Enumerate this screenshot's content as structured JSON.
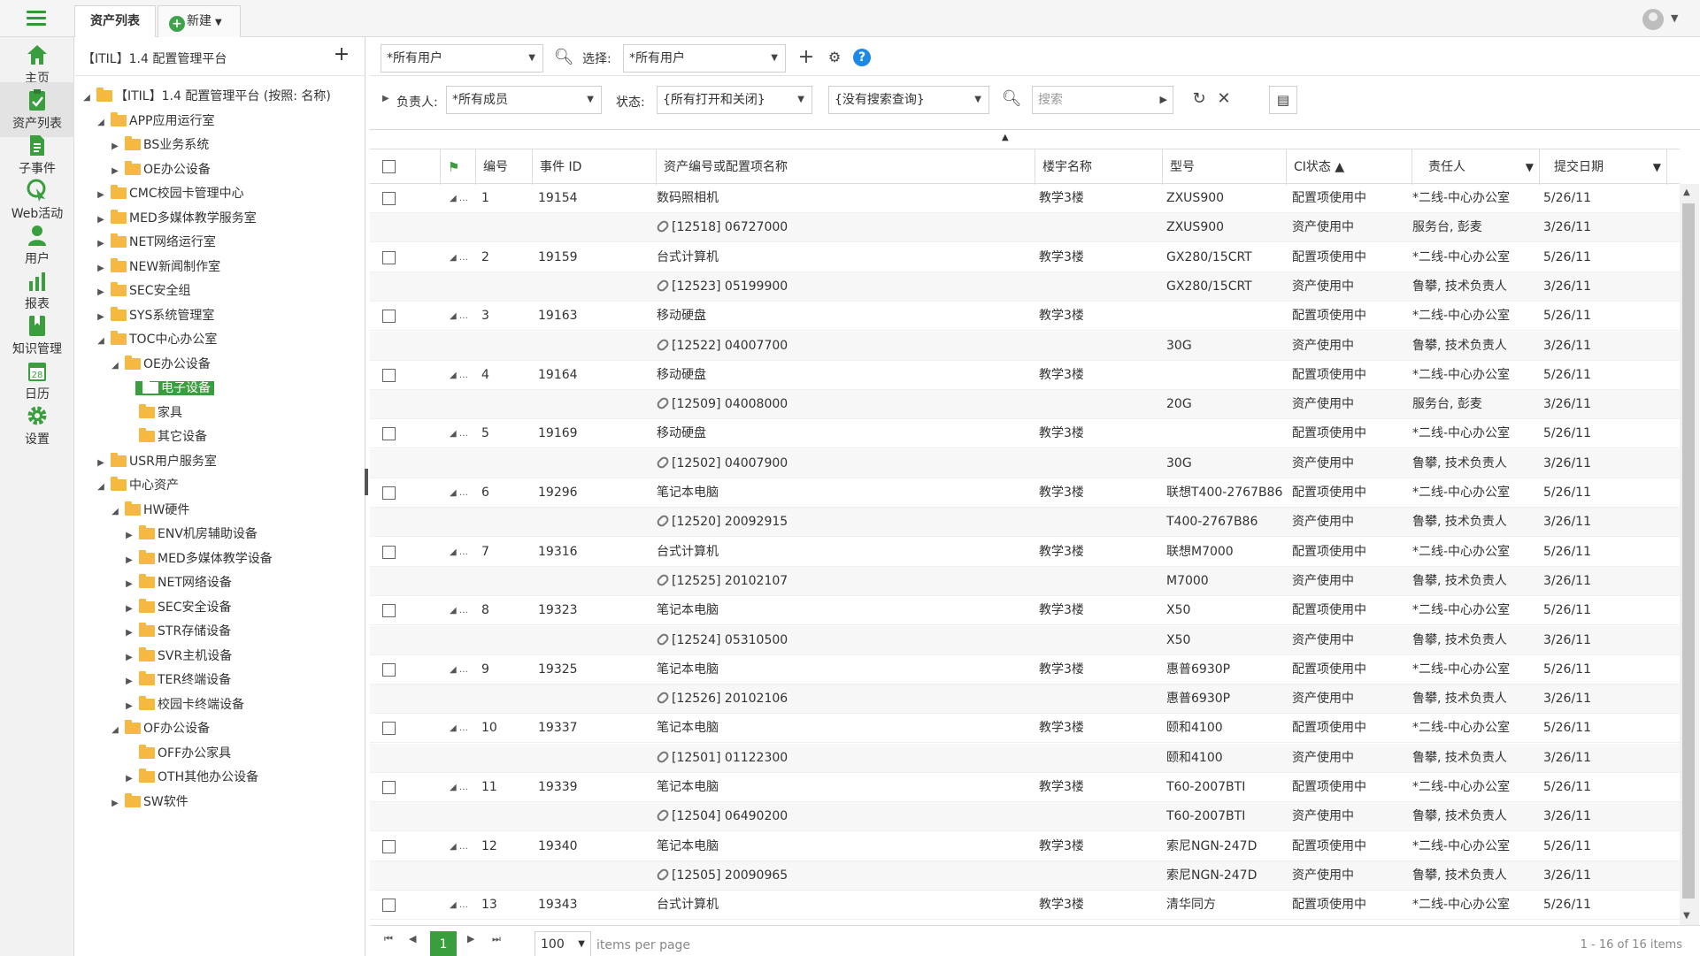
{
  "top": {
    "tabs": [
      {
        "label": "资产列表"
      },
      {
        "label": "新建"
      }
    ]
  },
  "nav": {
    "items": [
      {
        "label": "主页",
        "icon": "home-icon"
      },
      {
        "label": "资产列表",
        "icon": "clipboard-check-icon"
      },
      {
        "label": "子事件",
        "icon": "document-icon"
      },
      {
        "label": "Web活动",
        "icon": "cursor-icon"
      },
      {
        "label": "用户",
        "icon": "user-icon"
      },
      {
        "label": "报表",
        "icon": "bar-chart-icon"
      },
      {
        "label": "知识管理",
        "icon": "bookmark-icon"
      },
      {
        "label": "日历",
        "icon": "calendar-icon"
      },
      {
        "label": "设置",
        "icon": "gear-icon"
      }
    ],
    "calendar_day": "28",
    "collapse": "«"
  },
  "tree": {
    "title": "【ITIL】1.4 配置管理平台",
    "nodes": [
      {
        "label": "【ITIL】1.4 配置管理平台 (按照: 名称)",
        "level": 0,
        "toggle": "◢"
      },
      {
        "label": "APP应用运行室",
        "level": 1,
        "toggle": "◢"
      },
      {
        "label": "BS业务系统",
        "level": 2,
        "toggle": "▶"
      },
      {
        "label": "OE办公设备",
        "level": 2,
        "toggle": "▶"
      },
      {
        "label": "CMC校园卡管理中心",
        "level": 1,
        "toggle": "▶"
      },
      {
        "label": "MED多媒体教学服务室",
        "level": 1,
        "toggle": "▶"
      },
      {
        "label": "NET网络运行室",
        "level": 1,
        "toggle": "▶"
      },
      {
        "label": "NEW新闻制作室",
        "level": 1,
        "toggle": "▶"
      },
      {
        "label": "SEC安全组",
        "level": 1,
        "toggle": "▶"
      },
      {
        "label": "SYS系统管理室",
        "level": 1,
        "toggle": "▶"
      },
      {
        "label": "TOC中心办公室",
        "level": 1,
        "toggle": "◢"
      },
      {
        "label": "OE办公设备",
        "level": 2,
        "toggle": "◢"
      },
      {
        "label": "电子设备",
        "level": 3,
        "toggle": "",
        "selected": true
      },
      {
        "label": "家具",
        "level": 3,
        "toggle": ""
      },
      {
        "label": "其它设备",
        "level": 3,
        "toggle": ""
      },
      {
        "label": "USR用户服务室",
        "level": 1,
        "toggle": "▶"
      },
      {
        "label": "中心资产",
        "level": 1,
        "toggle": "◢"
      },
      {
        "label": "HW硬件",
        "level": 2,
        "toggle": "◢"
      },
      {
        "label": "ENV机房辅助设备",
        "level": 3,
        "toggle": "▶"
      },
      {
        "label": "MED多媒体教学设备",
        "level": 3,
        "toggle": "▶"
      },
      {
        "label": "NET网络设备",
        "level": 3,
        "toggle": "▶"
      },
      {
        "label": "SEC安全设备",
        "level": 3,
        "toggle": "▶"
      },
      {
        "label": "STR存储设备",
        "level": 3,
        "toggle": "▶"
      },
      {
        "label": "SVR主机设备",
        "level": 3,
        "toggle": "▶"
      },
      {
        "label": "TER终端设备",
        "level": 3,
        "toggle": "▶"
      },
      {
        "label": "校园卡终端设备",
        "level": 3,
        "toggle": "▶"
      },
      {
        "label": "OF办公设备",
        "level": 2,
        "toggle": "◢"
      },
      {
        "label": "OFF办公家具",
        "level": 3,
        "toggle": ""
      },
      {
        "label": "OTH其他办公设备",
        "level": 3,
        "toggle": "▶"
      },
      {
        "label": "SW软件",
        "level": 2,
        "toggle": "▶"
      }
    ]
  },
  "toolbar1": {
    "user_filter": "*所有用户",
    "select_label": "选择:",
    "select_value": "*所有用户"
  },
  "toolbar2": {
    "owner_label": "负责人:",
    "owner_value": "*所有成员",
    "status_label": "状态:",
    "status_value": "{所有打开和关闭}",
    "query_value": "{没有搜索查询}",
    "search_placeholder": "搜索"
  },
  "grid": {
    "columns": [
      "编号",
      "事件 ID",
      "资产编号或配置项名称",
      "楼宇名称",
      "型号",
      "CI状态 ▲",
      "责任人",
      "提交日期"
    ],
    "rows": [
      {
        "type": "main",
        "no": "1",
        "id": "19154",
        "name": "数码照相机",
        "building": "教学3楼",
        "model": "ZXUS900",
        "status": "配置项使用中",
        "owner": "*二线-中心办公室",
        "date": "5/26/11"
      },
      {
        "type": "sub",
        "name": "[12518] 06727000",
        "model": "ZXUS900",
        "status": "资产使用中",
        "owner": "服务台, 彭麦",
        "date": "3/26/11"
      },
      {
        "type": "main",
        "no": "2",
        "id": "19159",
        "name": "台式计算机",
        "building": "教学3楼",
        "model": "GX280/15CRT",
        "status": "配置项使用中",
        "owner": "*二线-中心办公室",
        "date": "5/26/11"
      },
      {
        "type": "sub",
        "name": "[12523] 05199900",
        "model": "GX280/15CRT",
        "status": "资产使用中",
        "owner": "鲁攀, 技术负责人",
        "date": "3/26/11"
      },
      {
        "type": "main",
        "no": "3",
        "id": "19163",
        "name": "移动硬盘",
        "building": "教学3楼",
        "model": "",
        "status": "配置项使用中",
        "owner": "*二线-中心办公室",
        "date": "5/26/11"
      },
      {
        "type": "sub",
        "name": "[12522] 04007700",
        "model": "30G",
        "status": "资产使用中",
        "owner": "鲁攀, 技术负责人",
        "date": "3/26/11"
      },
      {
        "type": "main",
        "no": "4",
        "id": "19164",
        "name": "移动硬盘",
        "building": "教学3楼",
        "model": "",
        "status": "配置项使用中",
        "owner": "*二线-中心办公室",
        "date": "5/26/11"
      },
      {
        "type": "sub",
        "name": "[12509] 04008000",
        "model": "20G",
        "status": "资产使用中",
        "owner": "服务台, 彭麦",
        "date": "3/26/11"
      },
      {
        "type": "main",
        "no": "5",
        "id": "19169",
        "name": "移动硬盘",
        "building": "教学3楼",
        "model": "",
        "status": "配置项使用中",
        "owner": "*二线-中心办公室",
        "date": "5/26/11"
      },
      {
        "type": "sub",
        "name": "[12502] 04007900",
        "model": "30G",
        "status": "资产使用中",
        "owner": "鲁攀, 技术负责人",
        "date": "3/26/11"
      },
      {
        "type": "main",
        "no": "6",
        "id": "19296",
        "name": "笔记本电脑",
        "building": "教学3楼",
        "model": "联想T400-2767B86",
        "status": "配置项使用中",
        "owner": "*二线-中心办公室",
        "date": "5/26/11"
      },
      {
        "type": "sub",
        "name": "[12520] 20092915",
        "model": "T400-2767B86",
        "status": "资产使用中",
        "owner": "鲁攀, 技术负责人",
        "date": "3/26/11"
      },
      {
        "type": "main",
        "no": "7",
        "id": "19316",
        "name": "台式计算机",
        "building": "教学3楼",
        "model": "联想M7000",
        "status": "配置项使用中",
        "owner": "*二线-中心办公室",
        "date": "5/26/11"
      },
      {
        "type": "sub",
        "name": "[12525] 20102107",
        "model": "M7000",
        "status": "资产使用中",
        "owner": "鲁攀, 技术负责人",
        "date": "3/26/11"
      },
      {
        "type": "main",
        "no": "8",
        "id": "19323",
        "name": "笔记本电脑",
        "building": "教学3楼",
        "model": "X50",
        "status": "配置项使用中",
        "owner": "*二线-中心办公室",
        "date": "5/26/11"
      },
      {
        "type": "sub",
        "name": "[12524] 05310500",
        "model": "X50",
        "status": "资产使用中",
        "owner": "鲁攀, 技术负责人",
        "date": "3/26/11"
      },
      {
        "type": "main",
        "no": "9",
        "id": "19325",
        "name": "笔记本电脑",
        "building": "教学3楼",
        "model": "惠普6930P",
        "status": "配置项使用中",
        "owner": "*二线-中心办公室",
        "date": "5/26/11"
      },
      {
        "type": "sub",
        "name": "[12526] 20102106",
        "model": "惠普6930P",
        "status": "资产使用中",
        "owner": "鲁攀, 技术负责人",
        "date": "3/26/11"
      },
      {
        "type": "main",
        "no": "10",
        "id": "19337",
        "name": "笔记本电脑",
        "building": "教学3楼",
        "model": "颐和4100",
        "status": "配置项使用中",
        "owner": "*二线-中心办公室",
        "date": "5/26/11"
      },
      {
        "type": "sub",
        "name": "[12501] 01122300",
        "model": "颐和4100",
        "status": "资产使用中",
        "owner": "鲁攀, 技术负责人",
        "date": "3/26/11"
      },
      {
        "type": "main",
        "no": "11",
        "id": "19339",
        "name": "笔记本电脑",
        "building": "教学3楼",
        "model": "T60-2007BTI",
        "status": "配置项使用中",
        "owner": "*二线-中心办公室",
        "date": "5/26/11"
      },
      {
        "type": "sub",
        "name": "[12504] 06490200",
        "model": "T60-2007BTI",
        "status": "资产使用中",
        "owner": "鲁攀, 技术负责人",
        "date": "3/26/11"
      },
      {
        "type": "main",
        "no": "12",
        "id": "19340",
        "name": "笔记本电脑",
        "building": "教学3楼",
        "model": "索尼NGN-247D",
        "status": "配置项使用中",
        "owner": "*二线-中心办公室",
        "date": "5/26/11"
      },
      {
        "type": "sub",
        "name": "[12505] 20090965",
        "model": "索尼NGN-247D",
        "status": "资产使用中",
        "owner": "鲁攀, 技术负责人",
        "date": "3/26/11"
      },
      {
        "type": "main",
        "no": "13",
        "id": "19343",
        "name": "台式计算机",
        "building": "教学3楼",
        "model": "清华同方",
        "status": "配置项使用中",
        "owner": "*二线-中心办公室",
        "date": "5/26/11"
      }
    ]
  },
  "pager": {
    "current": "1",
    "page_size": "100",
    "items_per_page": "items per page",
    "info": "1 - 16 of 16 items"
  },
  "colors": {
    "accent": "#3a9e3e",
    "help": "#1e88e5"
  }
}
